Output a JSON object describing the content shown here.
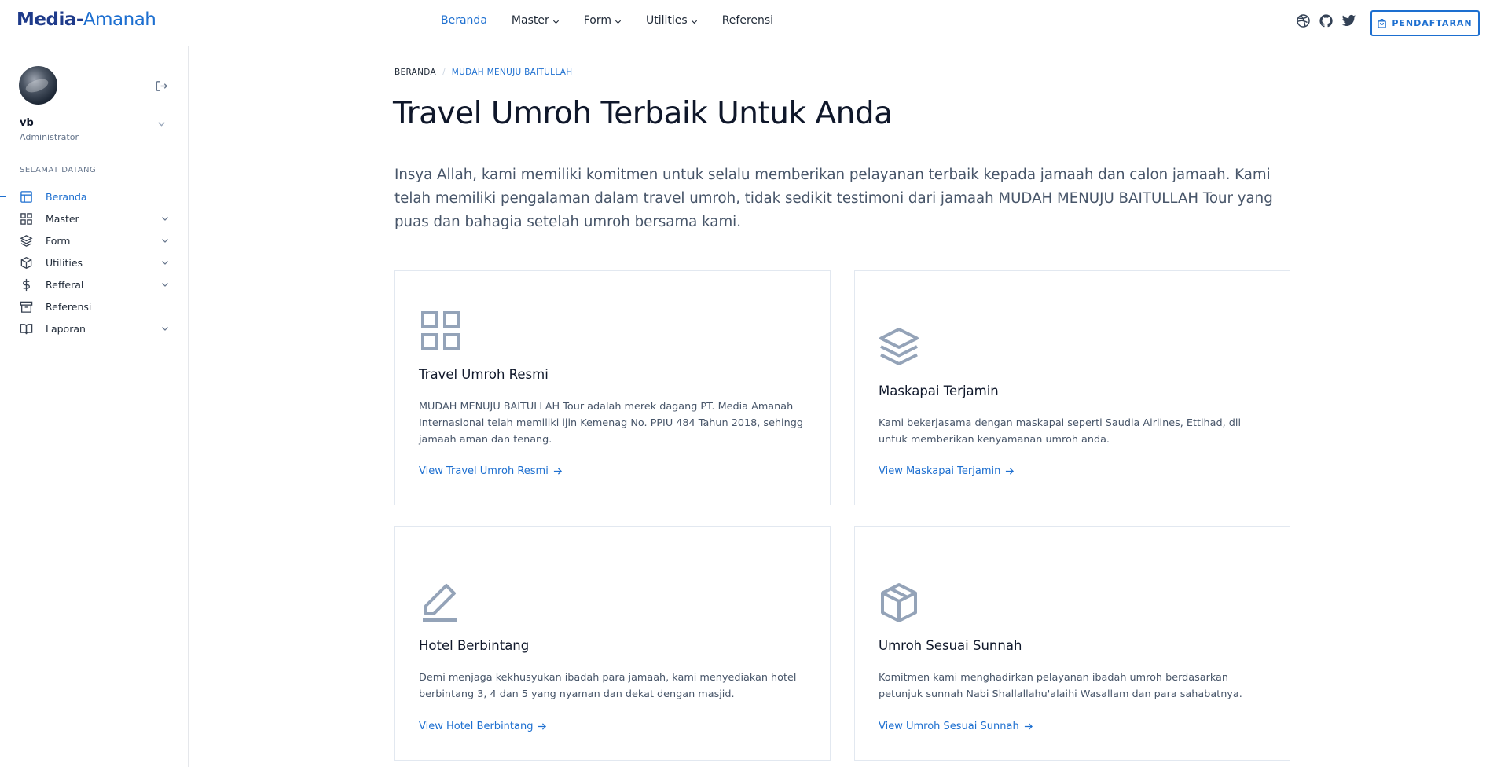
{
  "brand": {
    "part1": "Media-",
    "part2": "Amanah"
  },
  "topnav": {
    "items": [
      {
        "label": "Beranda",
        "active": true,
        "dropdown": false
      },
      {
        "label": "Master",
        "active": false,
        "dropdown": true
      },
      {
        "label": "Form",
        "active": false,
        "dropdown": true
      },
      {
        "label": "Utilities",
        "active": false,
        "dropdown": true
      },
      {
        "label": "Referensi",
        "active": false,
        "dropdown": false
      }
    ],
    "icons": [
      "dribbble-icon",
      "github-icon",
      "twitter-icon"
    ],
    "register_label": "PENDAFTARAN"
  },
  "sidebar": {
    "user_name": "vb",
    "user_role": "Administrator",
    "section_label": "SELAMAT DATANG",
    "items": [
      {
        "label": "Beranda",
        "icon": "layout-icon",
        "active": true,
        "dropdown": false
      },
      {
        "label": "Master",
        "icon": "grid-icon",
        "active": false,
        "dropdown": true
      },
      {
        "label": "Form",
        "icon": "layers-icon",
        "active": false,
        "dropdown": true
      },
      {
        "label": "Utilities",
        "icon": "box-icon",
        "active": false,
        "dropdown": true
      },
      {
        "label": "Refferal",
        "icon": "dollar-icon",
        "active": false,
        "dropdown": true
      },
      {
        "label": "Referensi",
        "icon": "archive-icon",
        "active": false,
        "dropdown": false
      },
      {
        "label": "Laporan",
        "icon": "book-icon",
        "active": false,
        "dropdown": true
      }
    ]
  },
  "breadcrumb": {
    "home": "BERANDA",
    "separator": "/",
    "current": "MUDAH MENUJU BAITULLAH"
  },
  "page_title": "Travel Umroh Terbaik Untuk Anda",
  "intro": "Insya Allah, kami memiliki komitmen untuk selalu memberikan pelayanan terbaik kepada jamaah dan calon jamaah. Kami telah memiliki pengalaman dalam travel umroh, tidak sedikit testimoni dari jamaah MUDAH MENUJU BAITULLAH Tour yang puas dan bahagia setelah umroh bersama kami.",
  "cards": [
    {
      "icon": "grid-icon",
      "title": "Travel Umroh Resmi",
      "text": "MUDAH MENUJU BAITULLAH Tour adalah merek dagang PT. Media Amanah Internasional telah memiliki ijin Kemenag No. PPIU 484 Tahun 2018, sehingg jamaah aman dan tenang.",
      "link": "View Travel Umroh Resmi"
    },
    {
      "icon": "layers-icon",
      "title": "Maskapai Terjamin",
      "text": "Kami bekerjasama dengan maskapai seperti Saudia Airlines, Ettihad, dll untuk memberikan kenyamanan umroh anda.",
      "link": "View Maskapai Terjamin"
    },
    {
      "icon": "edit-icon",
      "title": "Hotel Berbintang",
      "text": "Demi menjaga kekhusyukan ibadah para jamaah, kami menyediakan hotel berbintang 3, 4 dan 5 yang nyaman dan dekat dengan masjid.",
      "link": "View Hotel Berbintang"
    },
    {
      "icon": "box-icon",
      "title": "Umroh Sesuai Sunnah",
      "text": "Komitmen kami menghadirkan pelayanan ibadah umroh berdasarkan petunjuk sunnah Nabi Shallallahu'alaihi Wasallam dan para sahabatnya.",
      "link": "View Umroh Sesuai Sunnah"
    }
  ],
  "colors": {
    "accent": "#1d6fd0",
    "brand_dark": "#1e3a8a",
    "icon_muted": "#94a3b8"
  }
}
